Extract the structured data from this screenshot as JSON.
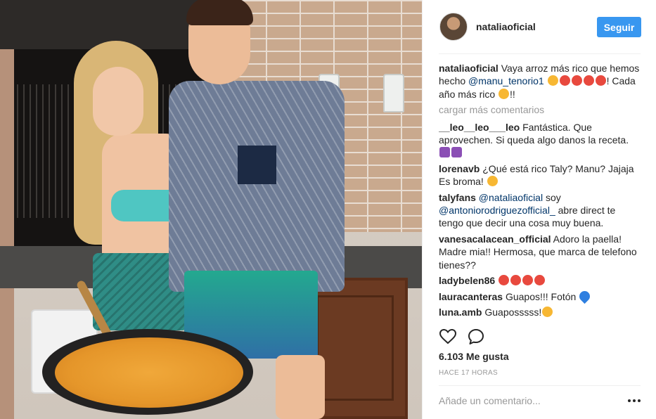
{
  "header": {
    "username": "nataliaoficial",
    "follow_label": "Seguir"
  },
  "comments": {
    "caption": {
      "user": "nataliaoficial",
      "text_a": " Vaya arroz más rico que hemos hecho ",
      "mention": "@manu_tenorio1",
      "text_b": " ",
      "text_c": "! Cada año más rico ",
      "text_d": "!!"
    },
    "load_more": "cargar más comentarios",
    "items": [
      {
        "user": "__leo__leo___leo",
        "text": " Fantástica. Que aprovechen. Si queda algo danos la receta. "
      },
      {
        "user": "lorenavb",
        "text": " ¿Qué está rico Taly? Manu? Jajaja Es broma! "
      },
      {
        "user": "talyfans",
        "mention1": " @nataliaoficial",
        "text_a": " soy ",
        "mention2": "@antoniorodriguezofficial_",
        "text_b": " abre direct te tengo que decir una cosa muy buena."
      },
      {
        "user": "vanesacalacean_official",
        "text": " Adoro la paella! Madre mia!! Hermosa, que marca de telefono tienes??"
      },
      {
        "user": "ladybelen86",
        "text": " "
      },
      {
        "user": "lauracanteras",
        "text": " Guapos!!! Fotón "
      },
      {
        "user": "luna.amb",
        "text": " Guaposssss!"
      }
    ]
  },
  "actions": {
    "like_icon": "heart-outline-icon",
    "comment_icon": "speech-bubble-icon"
  },
  "likes_label": "6.103 Me gusta",
  "time_label": "HACE 17 HORAS",
  "add_comment": {
    "placeholder": "Añade un comentario..."
  },
  "colors": {
    "follow_button": "#3897f0",
    "mention": "#003569",
    "muted": "#999999"
  }
}
